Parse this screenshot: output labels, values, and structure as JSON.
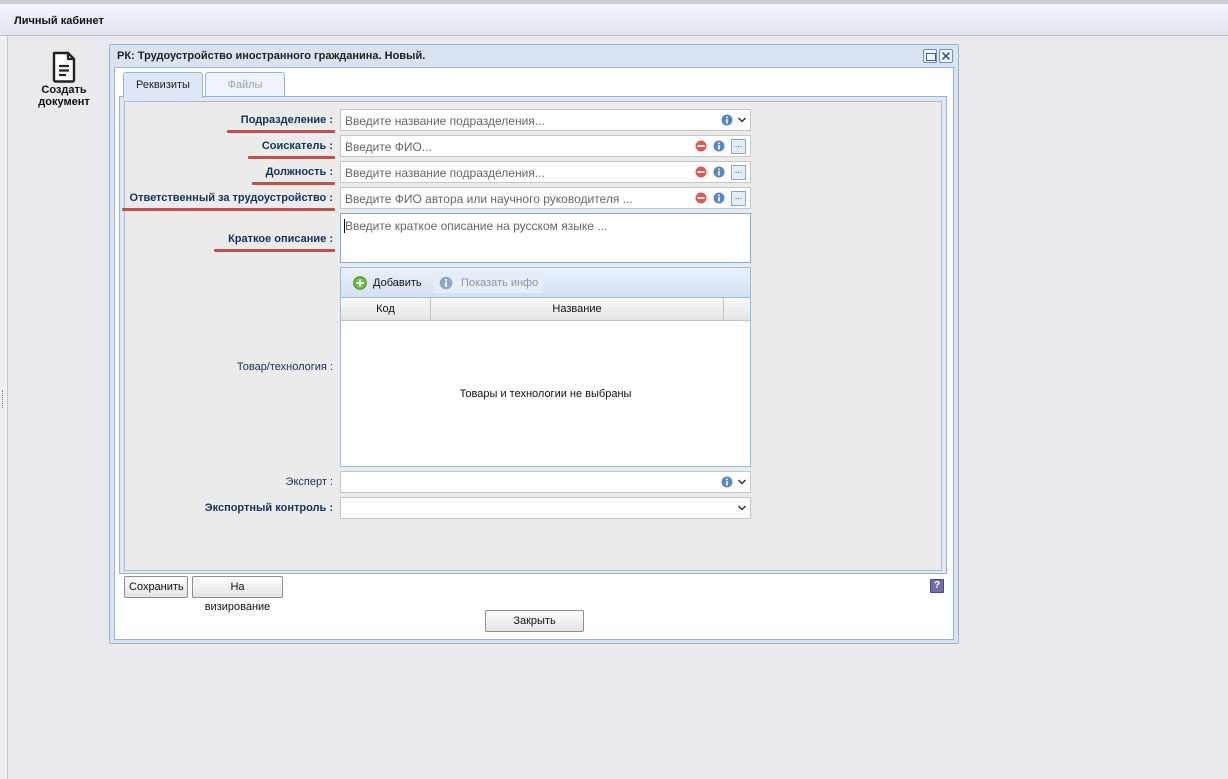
{
  "app": {
    "title": "Личный кабинет"
  },
  "sidebar": {
    "create_label_1": "Создать",
    "create_label_2": "документ",
    "create_icon": "document-icon"
  },
  "window": {
    "title": "РК: Трудоустройство иностранного гражданина. Новый.",
    "tabs": [
      {
        "label": "Реквизиты",
        "active": true
      },
      {
        "label": "Файлы",
        "active": false
      }
    ]
  },
  "form": {
    "subdivision": {
      "label": "Подразделение :",
      "placeholder": "Введите название подразделения..."
    },
    "applicant": {
      "label": "Соискатель :",
      "placeholder": "Введите ФИО..."
    },
    "position": {
      "label": "Должность :",
      "placeholder": "Введите название подразделения..."
    },
    "responsible": {
      "label": "Ответственный за трудоустройство :",
      "placeholder": "Введите ФИО автора или научного руководителя ..."
    },
    "description": {
      "label": "Краткое описание :",
      "placeholder": "Введите краткое описание на русском языке ..."
    },
    "goods": {
      "label": "Товар/технология :",
      "add_label": "Добавить",
      "info_label": "Показать инфо",
      "columns": [
        "Код",
        "Название"
      ],
      "empty_text": "Товары и технологии не выбраны"
    },
    "expert": {
      "label": "Эксперт :",
      "value": ""
    },
    "export_control": {
      "label": "Экспортный контроль :",
      "value": ""
    }
  },
  "actions": {
    "save": "Сохранить",
    "approve": "На визирование",
    "help": "?",
    "close": "Закрыть"
  },
  "colors": {
    "required_underline": "#c0504d",
    "label_text": "#15325f",
    "window_border": "#99b3d2"
  }
}
